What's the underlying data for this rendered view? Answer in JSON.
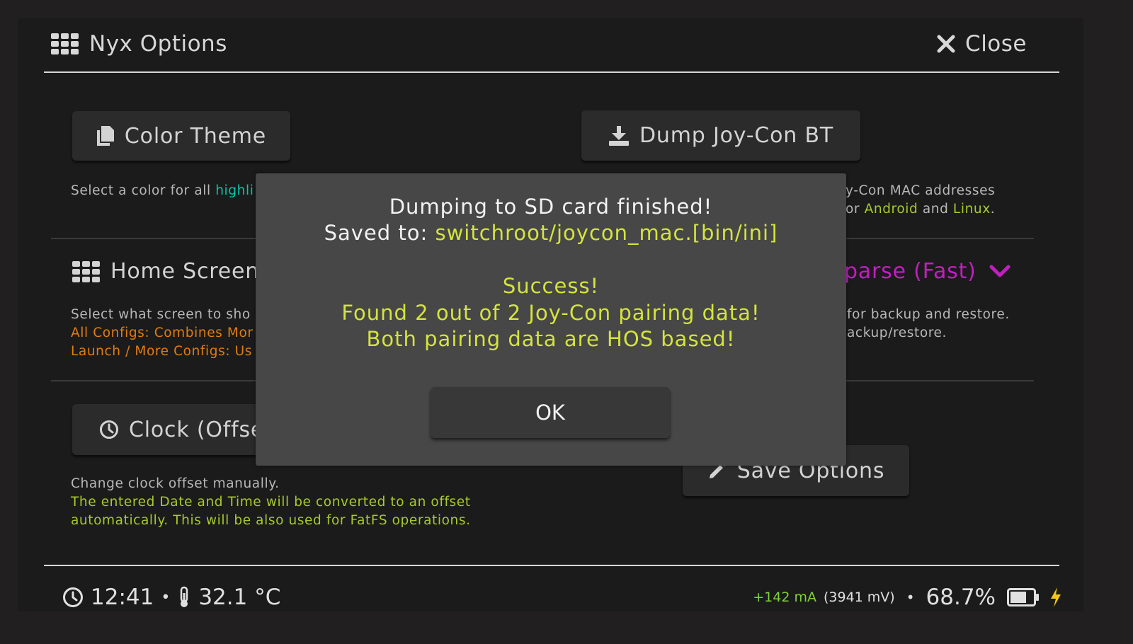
{
  "header": {
    "title": "Nyx Options",
    "close_label": "Close",
    "title_icon": "apps-grid-icon",
    "close_icon": "close-x-icon"
  },
  "options": {
    "color_theme": {
      "label": "Color Theme",
      "icon": "copy-icon",
      "desc_prefix": "Select a color for all ",
      "desc_highlight": "highli"
    },
    "dump_joycon": {
      "label": "Dump Joy-Con BT",
      "icon": "download-icon",
      "desc_line1": "y-Con MAC addresses",
      "desc_line2_prefix": "or ",
      "desc_android": "Android",
      "desc_and": " and ",
      "desc_linux": "Linux",
      "desc_period": "."
    },
    "home_screen": {
      "label": "Home Screen",
      "icon": "apps-grid-icon",
      "desc_line1": "Select what screen to sho",
      "desc_line2": "All Configs: Combines Mor",
      "desc_line3": "Launch / More Configs: Us"
    },
    "backup_mode": {
      "value": "parse (Fast)",
      "icon": "chevron-down-icon",
      "desc_line1": "for backup and restore.",
      "desc_line2": "ackup/restore."
    },
    "clock": {
      "label": "Clock (Offse",
      "icon": "clock-icon",
      "desc_line1": "Change clock offset manually.",
      "desc_line2": "The entered Date and Time will be converted to an offset",
      "desc_line3": "automatically. This will be also used for FatFS operations."
    },
    "save": {
      "label": "Save Options",
      "icon": "pencil-icon"
    }
  },
  "dialog": {
    "line1": "Dumping to SD card finished!",
    "line2_prefix": "Saved to: ",
    "line2_path": "switchroot/joycon_mac.[bin/ini]",
    "line3": "Success!",
    "line4": "Found 2 out of 2 Joy-Con pairing data!",
    "line5": "Both pairing data are HOS based!",
    "ok_label": "OK"
  },
  "status": {
    "time": "12:41",
    "separator": "•",
    "temperature": "32.1 °C",
    "current": "+142 mA",
    "voltage": "(3941 mV)",
    "battery_percent": "68.7%",
    "battery_level": 0.687,
    "charging": true
  },
  "colors": {
    "accent_cyan": "#00c8a5",
    "accent_orange": "#e07c10",
    "accent_green": "#a7c92c",
    "dropdown_magenta": "#c020c0",
    "dialog_highlight": "#d4e43c",
    "charge_bolt": "#f5c518"
  }
}
